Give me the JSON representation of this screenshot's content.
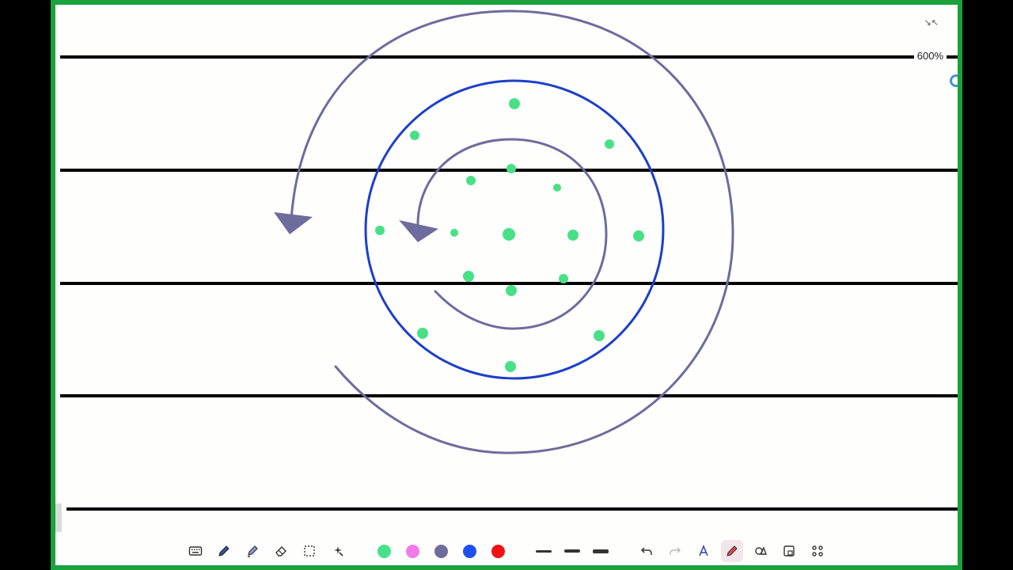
{
  "app": {
    "zoom_label": "600%"
  },
  "colors": {
    "frame_border": "#1aa23c",
    "paper": "#fefefd",
    "rule_line": "#000000",
    "spiral": "#6e6c9c",
    "circle": "#1d3fc8",
    "dots": "#48e087"
  },
  "canvas_drawing": {
    "ruled_lines": 5,
    "shapes": [
      {
        "kind": "spiral-arrow-outer",
        "color": "spiral"
      },
      {
        "kind": "circle",
        "color": "circle"
      },
      {
        "kind": "spiral-arrow-inner",
        "color": "spiral"
      },
      {
        "kind": "dots",
        "color": "dots",
        "count": 18
      }
    ]
  },
  "toolbar": {
    "tools": [
      {
        "name": "keyboard-icon"
      },
      {
        "name": "pen-icon"
      },
      {
        "name": "highlighter-icon"
      },
      {
        "name": "eraser-icon"
      },
      {
        "name": "lasso-select-icon"
      },
      {
        "name": "magic-icon"
      }
    ],
    "colors": [
      "#46e18a",
      "#f27be8",
      "#6e6c9c",
      "#1e50f0",
      "#ee1313"
    ],
    "stroke_sizes": [
      "thin",
      "medium",
      "thick"
    ],
    "actions": [
      {
        "name": "undo-icon"
      },
      {
        "name": "redo-icon"
      },
      {
        "name": "text-style-icon"
      },
      {
        "name": "pencil-icon"
      },
      {
        "name": "shapes-icon"
      },
      {
        "name": "lock-icon"
      },
      {
        "name": "more-apps-icon"
      }
    ]
  }
}
